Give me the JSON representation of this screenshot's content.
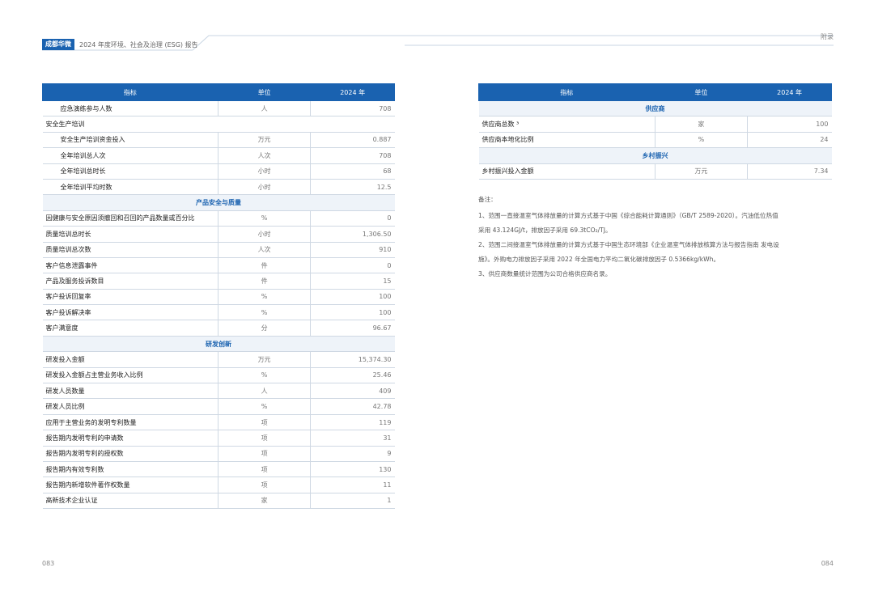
{
  "header": {
    "brand": "成都华微",
    "report_title": "2024 年度环境、社会及治理 (ESG) 报告",
    "section": "附录"
  },
  "left_table": {
    "columns": [
      "指标",
      "单位",
      "2024 年"
    ],
    "rows": [
      {
        "type": "row",
        "indent": true,
        "name": "应急演练参与人数",
        "unit": "人",
        "value": "708"
      },
      {
        "type": "group",
        "name": "安全生产培训"
      },
      {
        "type": "row",
        "indent": true,
        "name": "安全生产培训资金投入",
        "unit": "万元",
        "value": "0.887"
      },
      {
        "type": "row",
        "indent": true,
        "name": "全年培训总人次",
        "unit": "人次",
        "value": "708"
      },
      {
        "type": "row",
        "indent": true,
        "name": "全年培训总时长",
        "unit": "小时",
        "value": "68"
      },
      {
        "type": "row",
        "indent": true,
        "name": "全年培训平均时数",
        "unit": "小时",
        "value": "12.5"
      },
      {
        "type": "section",
        "name": "产品安全与质量"
      },
      {
        "type": "row",
        "name": "因健康与安全原因须撤回和召回的产品数量或百分比",
        "unit": "%",
        "value": "0"
      },
      {
        "type": "row",
        "name": "质量培训总时长",
        "unit": "小时",
        "value": "1,306.50"
      },
      {
        "type": "row",
        "name": "质量培训总次数",
        "unit": "人次",
        "value": "910"
      },
      {
        "type": "row",
        "name": "客户信息泄露事件",
        "unit": "件",
        "value": "0"
      },
      {
        "type": "row",
        "name": "产品及服务投诉数目",
        "unit": "件",
        "value": "15"
      },
      {
        "type": "row",
        "name": "客户投诉回复率",
        "unit": "%",
        "value": "100"
      },
      {
        "type": "row",
        "name": "客户投诉解决率",
        "unit": "%",
        "value": "100"
      },
      {
        "type": "row",
        "name": "客户满意度",
        "unit": "分",
        "value": "96.67"
      },
      {
        "type": "section",
        "name": "研发创新"
      },
      {
        "type": "row",
        "name": "研发投入金额",
        "unit": "万元",
        "value": "15,374.30"
      },
      {
        "type": "row",
        "name": "研发投入金额占主营业务收入比例",
        "unit": "%",
        "value": "25.46"
      },
      {
        "type": "row",
        "name": "研发人员数量",
        "unit": "人",
        "value": "409"
      },
      {
        "type": "row",
        "name": "研发人员比例",
        "unit": "%",
        "value": "42.78"
      },
      {
        "type": "row",
        "name": "应用于主营业务的发明专利数量",
        "unit": "项",
        "value": "119"
      },
      {
        "type": "row",
        "name": "报告期内发明专利的申请数",
        "unit": "项",
        "value": "31"
      },
      {
        "type": "row",
        "name": "报告期内发明专利的授权数",
        "unit": "项",
        "value": "9"
      },
      {
        "type": "row",
        "name": "报告期内有效专利数",
        "unit": "项",
        "value": "130"
      },
      {
        "type": "row",
        "name": "报告期内新增软件著作权数量",
        "unit": "项",
        "value": "11"
      },
      {
        "type": "row",
        "name": "高新技术企业认证",
        "unit": "家",
        "value": "1"
      }
    ]
  },
  "right_table": {
    "columns": [
      "指标",
      "单位",
      "2024 年"
    ],
    "rows": [
      {
        "type": "section",
        "name": "供应商"
      },
      {
        "type": "row",
        "name": "供应商总数 ³",
        "unit": "家",
        "value": "100"
      },
      {
        "type": "row",
        "name": "供应商本地化比例",
        "unit": "%",
        "value": "24"
      },
      {
        "type": "section",
        "name": "乡村振兴"
      },
      {
        "type": "row",
        "name": "乡村振兴投入金额",
        "unit": "万元",
        "value": "7.34"
      }
    ]
  },
  "notes": {
    "title": "备注：",
    "lines": [
      "1、范围一直接温室气体排放量的计算方式基于中国《综合能耗计算通则》（GB/T 2589-2020）。汽油低位热值",
      "采用 43.124GJ/t，排放因子采用 69.3tCO₂/TJ。",
      "2、范围二间接温室气体排放量的计算方式基于中国生态环境部《企业温室气体排放核算方法与报告指南 发电设",
      "施》。外购电力排放因子采用 2022 年全国电力平均二氧化碳排放因子 0.5366kg/kWh。",
      "3、供应商数量统计范围为公司合格供应商名录。"
    ]
  },
  "page_numbers": {
    "left": "083",
    "right": "084"
  },
  "colors": {
    "accent": "#1a62b0",
    "section_bg": "#eef3f9"
  }
}
